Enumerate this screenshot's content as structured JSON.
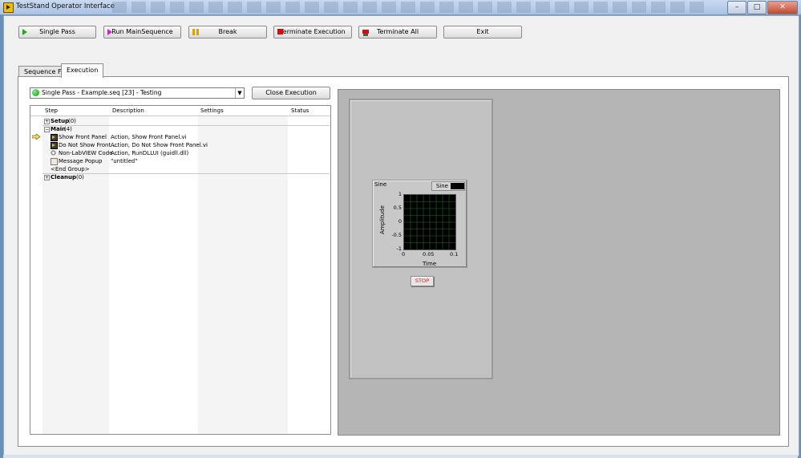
{
  "window": {
    "title": "TestStand Operator Interface",
    "minimize": "–",
    "maximize": "□",
    "close": "✕"
  },
  "toolbar": {
    "single_pass": "Single Pass",
    "run_main": "Run MainSequence",
    "break": "Break",
    "terminate_execution": "Terminate Execution",
    "terminate_all": "Terminate All",
    "exit": "Exit"
  },
  "tabs": {
    "sequence_file": "Sequence File",
    "execution": "Execution"
  },
  "execution": {
    "selected": "Single Pass - Example.seq [23] - Testing",
    "close_button": "Close Execution"
  },
  "grid": {
    "headers": {
      "step": "Step",
      "description": "Description",
      "settings": "Settings",
      "status": "Status"
    },
    "setup": {
      "name": "Setup",
      "count": "(0)"
    },
    "main": {
      "name": "Main",
      "count": "(4)"
    },
    "steps": [
      {
        "name": "Show Front Panel",
        "description": "Action,  Show Front Panel.vi"
      },
      {
        "name": "Do Not Show Front ...",
        "description": "Action,  Do Not Show Front Panel.vi"
      },
      {
        "name": "Non-LabVIEW Code ...",
        "description": "Action,  RunDLLUI (guidll.dll)"
      },
      {
        "name": "Message Popup",
        "description": "\"untitled\""
      }
    ],
    "end_group": "<End Group>",
    "cleanup": {
      "name": "Cleanup",
      "count": "(0)"
    }
  },
  "front_panel": {
    "chart_title": "Sine",
    "legend_label": "Sine",
    "stop_label": "STOP"
  },
  "chart_data": {
    "type": "line",
    "title": "",
    "xlabel": "Time",
    "ylabel": "Amplitude",
    "xlim": [
      0,
      0.1
    ],
    "ylim": [
      -1,
      1
    ],
    "x_ticks": [
      "0",
      "0.05",
      "0.1"
    ],
    "y_ticks": [
      "1",
      "0.5",
      "0",
      "-0.5",
      "-1"
    ],
    "grid": true,
    "series": [
      {
        "name": "Sine",
        "values": []
      }
    ],
    "plot_background": "#000000",
    "grid_color": "#1f6e1f"
  }
}
